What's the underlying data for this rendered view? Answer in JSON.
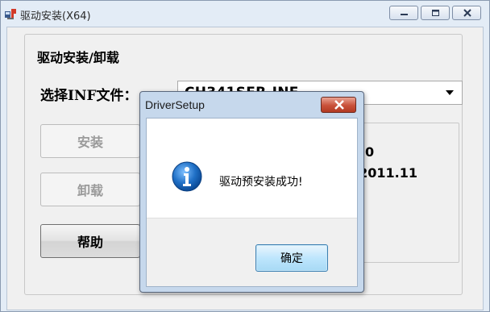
{
  "window": {
    "title": "驱动安装(X64)",
    "buttons": [
      "minimize-icon",
      "maximize-icon",
      "close-icon"
    ]
  },
  "main": {
    "group_title": "驱动安装/卸载",
    "inf_label": "选择INF文件：",
    "inf_selected": "CH341SER.INF",
    "buttons": {
      "install": "安装",
      "uninstall": "卸载",
      "help": "帮助"
    },
    "info_lines": {
      "line1": "0",
      "line2": ".2011.11"
    }
  },
  "dialog": {
    "title": "DriverSetup",
    "icon": "info-icon",
    "message": "驱动预安装成功!",
    "ok_label": "确定"
  },
  "colors": {
    "title_bg": "#e3ecf6",
    "client_bg": "#f0f0f0",
    "dialog_close": "#c9513a",
    "info_icon": "#1f6fc5",
    "ok_button_border": "#3c7fb1"
  }
}
